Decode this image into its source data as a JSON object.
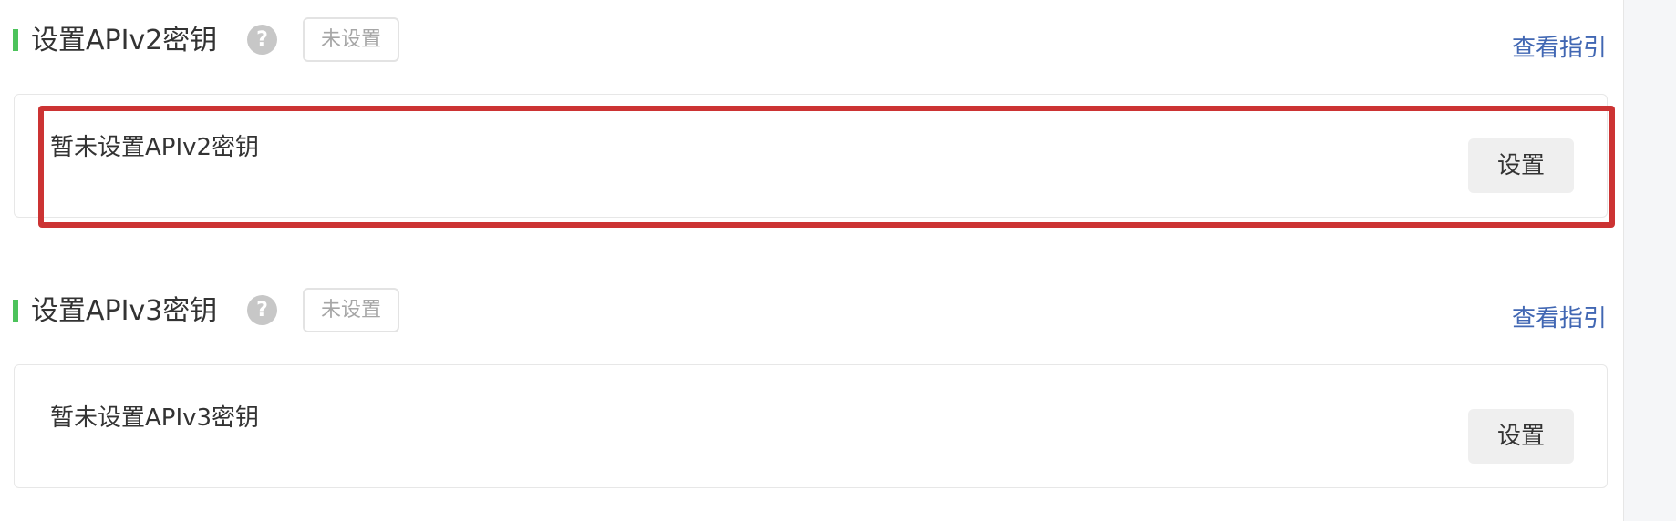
{
  "sections": [
    {
      "title": "设置APIv2密钥",
      "help_icon": "question-mark-icon",
      "status_badge": "未设置",
      "guide_link": "查看指引",
      "card_text": "暂未设置APIv2密钥",
      "button_label": "设置"
    },
    {
      "title": "设置APIv3密钥",
      "help_icon": "question-mark-icon",
      "status_badge": "未设置",
      "guide_link": "查看指引",
      "card_text": "暂未设置APIv3密钥",
      "button_label": "设置"
    }
  ],
  "help_glyph": "?",
  "colors": {
    "accent_green": "#4cc35b",
    "link_blue": "#4167b3",
    "highlight_red": "#cc3333",
    "help_icon_gray": "#c7c7c7"
  }
}
